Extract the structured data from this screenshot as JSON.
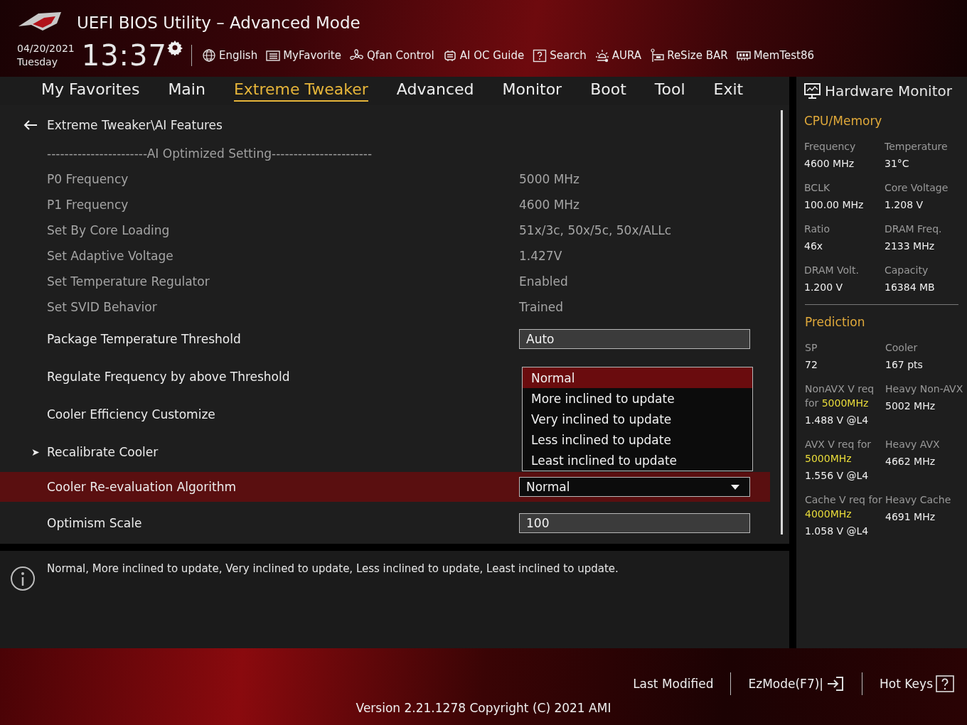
{
  "header": {
    "title": "UEFI BIOS Utility – Advanced Mode",
    "date": "04/20/2021",
    "day": "Tuesday",
    "time": "13:37",
    "toolbar": [
      "English",
      "MyFavorite",
      "Qfan Control",
      "AI OC Guide",
      "Search",
      "AURA",
      "ReSize BAR",
      "MemTest86"
    ]
  },
  "tabs": [
    {
      "label": "My Favorites",
      "selected": false
    },
    {
      "label": "Main",
      "selected": false
    },
    {
      "label": "Extreme Tweaker",
      "selected": true
    },
    {
      "label": "Advanced",
      "selected": false
    },
    {
      "label": "Monitor",
      "selected": false
    },
    {
      "label": "Boot",
      "selected": false
    },
    {
      "label": "Tool",
      "selected": false
    },
    {
      "label": "Exit",
      "selected": false
    }
  ],
  "breadcrumb": "Extreme Tweaker\\AI Features",
  "settings": [
    {
      "kind": "section",
      "label": "-----------------------AI Optimized Setting-----------------------"
    },
    {
      "kind": "info",
      "label": "P0 Frequency",
      "value": "5000 MHz"
    },
    {
      "kind": "info",
      "label": "P1 Frequency",
      "value": "4600 MHz"
    },
    {
      "kind": "info",
      "label": "Set By Core Loading",
      "value": "51x/3c, 50x/5c, 50x/ALLc"
    },
    {
      "kind": "info",
      "label": "Set Adaptive Voltage",
      "value": "1.427V"
    },
    {
      "kind": "info",
      "label": "Set Temperature Regulator",
      "value": "Enabled"
    },
    {
      "kind": "info",
      "label": "Set SVID Behavior",
      "value": "Trained"
    },
    {
      "kind": "field",
      "label": "Package Temperature Threshold",
      "value": "Auto",
      "selected": false
    },
    {
      "kind": "plain",
      "label": "Regulate Frequency by above Threshold",
      "selected": false
    },
    {
      "kind": "plain",
      "label": "Cooler Efficiency Customize",
      "selected": false
    },
    {
      "kind": "submenu",
      "label": "Recalibrate Cooler",
      "icon": "➤",
      "selected": false
    },
    {
      "kind": "dropdown",
      "label": "Cooler Re-evaluation Algorithm",
      "value": "Normal",
      "selected": true,
      "expanded": true,
      "options": [
        {
          "label": "Normal",
          "selected": true
        },
        {
          "label": "More inclined to update",
          "selected": false
        },
        {
          "label": "Very inclined to update",
          "selected": false
        },
        {
          "label": "Less inclined to update",
          "selected": false
        },
        {
          "label": "Least inclined to update",
          "selected": false
        }
      ]
    },
    {
      "kind": "field",
      "label": "Optimism Scale",
      "value": "100",
      "selected": false
    }
  ],
  "help_text": "Normal, More inclined to update, Very inclined to update, Less inclined to update, Least inclined to update.",
  "hardware_monitor": {
    "title": "Hardware Monitor",
    "sections": [
      {
        "title": "CPU/Memory",
        "items": [
          {
            "label": "Frequency",
            "value": "4600 MHz"
          },
          {
            "label": "Temperature",
            "value": "31°C"
          },
          {
            "label": "BCLK",
            "value": "100.00 MHz"
          },
          {
            "label": "Core Voltage",
            "value": "1.208 V"
          },
          {
            "label": "Ratio",
            "value": "46x"
          },
          {
            "label": "DRAM Freq.",
            "value": "2133 MHz"
          },
          {
            "label": "DRAM Volt.",
            "value": "1.200 V"
          },
          {
            "label": "Capacity",
            "value": "16384 MB"
          }
        ]
      },
      {
        "title": "Prediction",
        "items": [
          {
            "label": "SP",
            "value": "72"
          },
          {
            "label": "Cooler",
            "value": "167 pts"
          },
          {
            "label": "NonAVX V req for",
            "target": "5000MHz",
            "value": "1.488 V @L4"
          },
          {
            "label": "Heavy Non-AVX",
            "value": "5002 MHz"
          },
          {
            "label": "AVX V req for",
            "target": "5000MHz",
            "value": "1.556 V @L4"
          },
          {
            "label": "Heavy AVX",
            "value": "4662 MHz"
          },
          {
            "label": "Cache V req for",
            "target": "4000MHz",
            "value": "1.058 V @L4"
          },
          {
            "label": "Heavy Cache",
            "value": "4691 MHz"
          }
        ]
      }
    ]
  },
  "footer": {
    "buttons": [
      "Last Modified",
      "EzMode(F7)|",
      "Hot Keys"
    ],
    "version": "Version 2.21.1278 Copyright (C) 2021 AMI"
  }
}
